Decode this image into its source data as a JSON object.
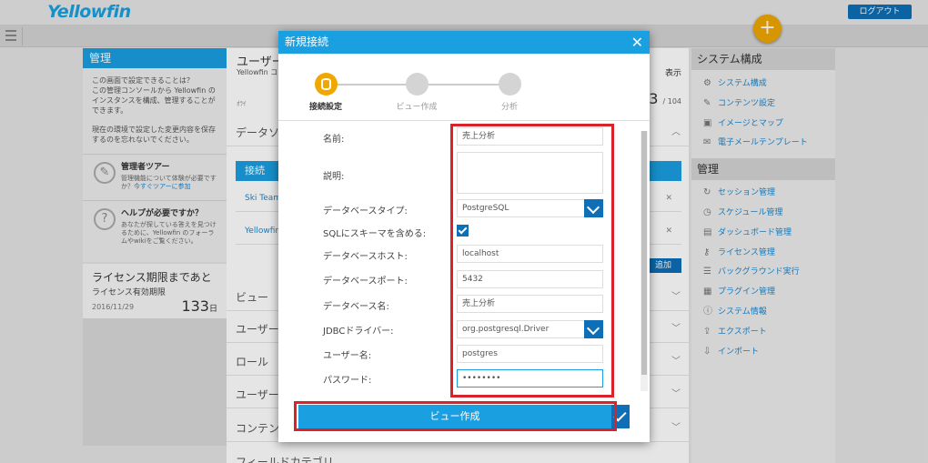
{
  "app": {
    "logo": "Yellowfin",
    "logout": "ログアウト",
    "plus": "+"
  },
  "left": {
    "title": "管理",
    "intro_q": "この画面で設定できることは？",
    "intro": "この管理コンソールから Yellowfin のインスタンスを構成、管理することができます。",
    "note": "現在の環境で設定した変更内容を保存するのを忘れないでください。",
    "tour_title": "管理者ツアー",
    "tour_desc": "管理機能について体験が必要ですか？",
    "tour_link": "今すぐツアーに参加",
    "help_title": "ヘルプが必要ですか？",
    "help_desc": "あなたが探している答えを見つけるために、Yellowfin のフォーラムやwikiをご覧ください。",
    "license_title": "ライセンス期限まであと",
    "license_sub": "ライセンス有効期限",
    "license_date": "2016/11/29",
    "license_days": "133",
    "license_unit": "日"
  },
  "center": {
    "title": "ユーザー",
    "sub": "Yellowfin コ",
    "stat_label": "表示",
    "stat_num": "3",
    "stat_total": "/ 104",
    "sub2": "ｵﾗｲ",
    "section_data": "データソ",
    "table_head": "接続",
    "row1": "Ski Team",
    "row2": "Yellowfin",
    "add": "追加",
    "sec_view": "ビュー",
    "sec_user": "ユーザー",
    "sec_role": "ロール",
    "sec_user2": "ユーザー",
    "sec_content": "コンテン",
    "sec_field": "フィールドカテゴリ"
  },
  "right": {
    "system_title": "システム構成",
    "system_items": [
      {
        "icon": "⚙",
        "label": "システム構成"
      },
      {
        "icon": "✎",
        "label": "コンテンツ設定"
      },
      {
        "icon": "▣",
        "label": "イメージとマップ"
      },
      {
        "icon": "✉",
        "label": "電子メールテンプレート"
      }
    ],
    "admin_title": "管理",
    "admin_items": [
      {
        "icon": "↻",
        "label": "セッション管理"
      },
      {
        "icon": "◷",
        "label": "スケジュール管理"
      },
      {
        "icon": "▤",
        "label": "ダッシュボード管理"
      },
      {
        "icon": "⚷",
        "label": "ライセンス管理"
      },
      {
        "icon": "☰",
        "label": "バックグラウンド実行"
      },
      {
        "icon": "▦",
        "label": "プラグイン管理"
      },
      {
        "icon": "ⓘ",
        "label": "システム情報"
      },
      {
        "icon": "⇪",
        "label": "エクスポート"
      },
      {
        "icon": "⇩",
        "label": "インポート"
      }
    ]
  },
  "dialog": {
    "title": "新規接続",
    "steps": [
      "接続設定",
      "ビュー作成",
      "分析"
    ],
    "fields": {
      "name_label": "名前:",
      "name_value": "売上分析",
      "desc_label": "説明:",
      "dbtype_label": "データベースタイプ:",
      "dbtype_value": "PostgreSQL",
      "schema_label": "SQLにスキーマを含める:",
      "schema_checked": true,
      "host_label": "データベースホスト:",
      "host_value": "localhost",
      "port_label": "データベースポート:",
      "port_value": "5432",
      "dbname_label": "データベース名:",
      "dbname_value": "売上分析",
      "driver_label": "JDBCドライバー:",
      "driver_value": "org.postgresql.Driver",
      "user_label": "ユーザー名:",
      "user_value": "postgres",
      "pass_label": "パスワード:",
      "pass_value": "••••••••"
    },
    "button": "ビュー作成"
  },
  "colors": {
    "accent": "#1a9fe0",
    "dark_accent": "#0e6fb6",
    "highlight": "#d8232a",
    "plus": "#f0a800"
  }
}
